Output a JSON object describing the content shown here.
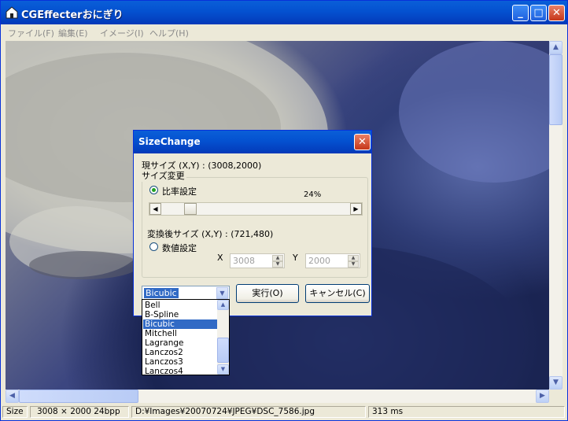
{
  "window": {
    "title": "CGEffecterおにぎり",
    "min_label": "_",
    "max_label": "□",
    "close_label": "✕"
  },
  "menu": [
    "ファイル(F)",
    "編集(E)",
    "イメージ(I)",
    "ヘルプ(H)"
  ],
  "status": {
    "mode": "Size",
    "dims": "3008 × 2000  24bpp",
    "path": "D:¥Images¥20070724¥JPEG¥DSC_7586.jpg",
    "time": "313 ms"
  },
  "dialog": {
    "title": "SizeChange",
    "current_size": "現サイズ (X,Y) : (3008,2000)",
    "group_label": "サイズ変更",
    "ratio_label": "比率設定",
    "percent": "24%",
    "converted_size": "変換後サイズ (X,Y) : (721,480)",
    "numeric_label": "数値設定",
    "x_label": "X",
    "y_label": "Y",
    "x_value": "3008",
    "y_value": "2000",
    "method_selected": "Bicubic",
    "execute_label": "実行(O)",
    "cancel_label": "キャンセル(C)"
  },
  "method_options": [
    "Bell",
    "B-Spline",
    "Bicubic",
    "Mitchell",
    "Lagrange",
    "Lanczos2",
    "Lanczos3",
    "Lanczos4"
  ],
  "colors": {
    "titlebar": "#0451d0",
    "selection": "#316ac5",
    "radio_dot": "#21a121"
  }
}
